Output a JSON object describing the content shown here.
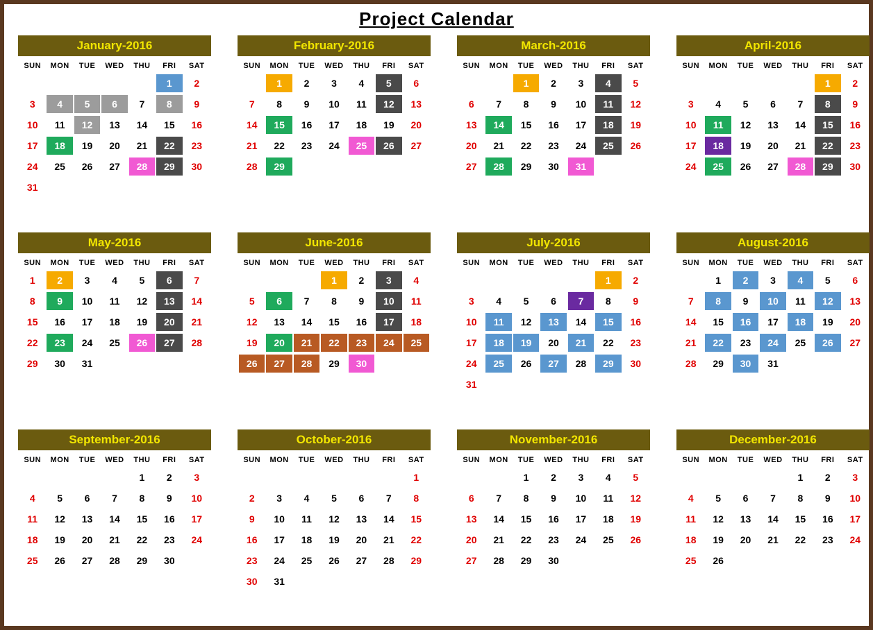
{
  "title": "Project  Calendar",
  "weekdays": [
    "SUN",
    "MON",
    "TUE",
    "WED",
    "THU",
    "FRI",
    "SAT"
  ],
  "months": [
    {
      "label": "January-2016",
      "startCol": 5,
      "days": 31,
      "hl": {
        "1": "blue",
        "4": "gray",
        "5": "gray",
        "6": "gray",
        "8": "gray",
        "12": "gray",
        "18": "green",
        "22": "dark",
        "28": "pink",
        "29": "dark"
      }
    },
    {
      "label": "February-2016",
      "startCol": 1,
      "days": 29,
      "hl": {
        "1": "yellow",
        "5": "dark",
        "12": "dark",
        "15": "green",
        "25": "pink",
        "26": "dark",
        "29": "green"
      }
    },
    {
      "label": "March-2016",
      "startCol": 2,
      "days": 31,
      "hl": {
        "1": "yellow",
        "4": "dark",
        "11": "dark",
        "14": "green",
        "18": "dark",
        "25": "dark",
        "28": "green",
        "31": "pink"
      }
    },
    {
      "label": "April-2016",
      "startCol": 5,
      "days": 30,
      "hl": {
        "1": "yellow",
        "8": "dark",
        "11": "green",
        "15": "dark",
        "18": "purple",
        "22": "dark",
        "25": "green",
        "28": "pink",
        "29": "dark"
      }
    },
    {
      "label": "May-2016",
      "startCol": 0,
      "days": 31,
      "hl": {
        "2": "yellow",
        "6": "dark",
        "9": "green",
        "13": "dark",
        "20": "dark",
        "23": "green",
        "26": "pink",
        "27": "dark"
      }
    },
    {
      "label": "June-2016",
      "startCol": 3,
      "days": 30,
      "hl": {
        "1": "yellow",
        "3": "dark",
        "6": "green",
        "10": "dark",
        "17": "dark",
        "20": "green",
        "21": "brown",
        "22": "brown",
        "23": "brown",
        "24": "brown",
        "25": "brown",
        "26": "brown",
        "27": "brown",
        "28": "brown",
        "30": "pink"
      }
    },
    {
      "label": "July-2016",
      "startCol": 5,
      "days": 31,
      "hl": {
        "1": "yellow",
        "7": "purple",
        "11": "blue",
        "13": "blue",
        "15": "blue",
        "18": "blue",
        "19": "blue",
        "21": "blue",
        "25": "blue",
        "27": "blue",
        "29": "blue"
      }
    },
    {
      "label": "August-2016",
      "startCol": 1,
      "days": 31,
      "hl": {
        "2": "blue",
        "4": "blue",
        "8": "blue",
        "10": "blue",
        "12": "blue",
        "16": "blue",
        "18": "blue",
        "22": "blue",
        "24": "blue",
        "26": "blue",
        "30": "blue"
      }
    },
    {
      "label": "September-2016",
      "startCol": 4,
      "days": 30,
      "hl": {}
    },
    {
      "label": "October-2016",
      "startCol": 6,
      "days": 31,
      "hl": {}
    },
    {
      "label": "November-2016",
      "startCol": 2,
      "days": 30,
      "hl": {}
    },
    {
      "label": "December-2016",
      "startCol": 4,
      "days": 31,
      "hl": {},
      "limitDisplay": 26
    }
  ]
}
